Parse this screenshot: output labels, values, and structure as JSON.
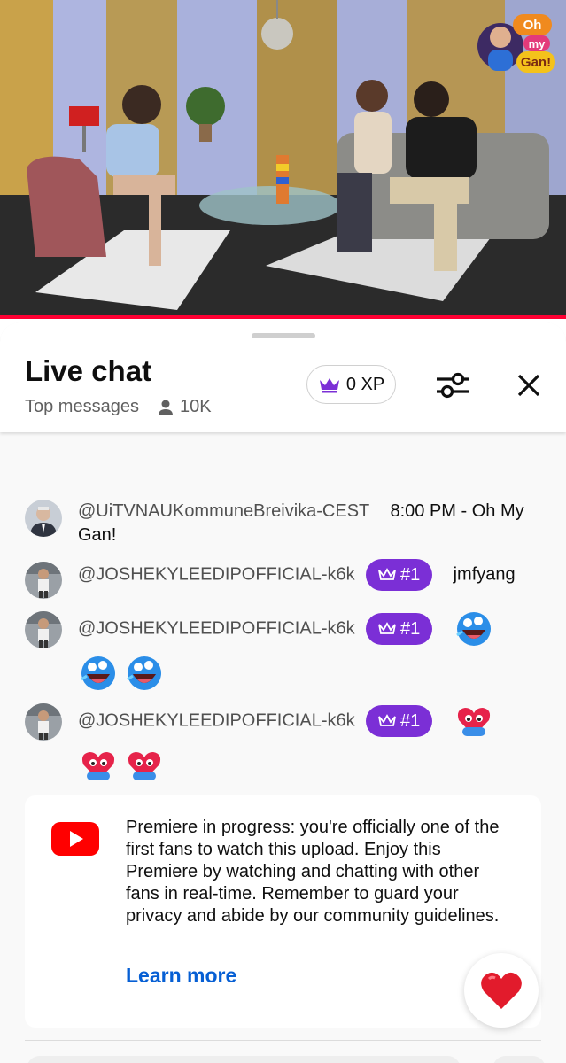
{
  "video": {
    "brand_logo_text": [
      "Oh",
      "my",
      "Gan!"
    ],
    "progress_color": "#ff0033"
  },
  "chat": {
    "title": "Live chat",
    "mode": "Top messages",
    "viewer_count": "10K",
    "xp_label": "0 XP",
    "accent_color": "#7b2fd6",
    "link_color": "#065fd4"
  },
  "messages": [
    {
      "author": "@UiTVNAUKommuneBreivika-CEST",
      "text": "8:00 PM - Oh My Gan!",
      "badge": "",
      "avatar": "avatar-man-suit",
      "emojis": []
    },
    {
      "author": "@JOSHEKYLEEDIPOFFICIAL-k6k",
      "text": "jmfyang",
      "badge": "#1",
      "avatar": "avatar-child",
      "emojis": []
    },
    {
      "author": "@JOSHEKYLEEDIPOFFICIAL-k6k",
      "text": "",
      "badge": "#1",
      "avatar": "avatar-child",
      "emojis": [
        "laughing-blue-emoji",
        "laughing-blue-emoji",
        "laughing-blue-emoji"
      ]
    },
    {
      "author": "@JOSHEKYLEEDIPOFFICIAL-k6k",
      "text": "",
      "badge": "#1",
      "avatar": "avatar-child",
      "emojis": [
        "hugging-heart-emoji",
        "hugging-heart-emoji",
        "hugging-heart-emoji"
      ]
    }
  ],
  "notice": {
    "text": "Premiere in progress: you're officially one of the first fans to watch this upload. Enjoy this Premiere by watching and chatting with other fans in real-time. Remember to guard your privacy and abide by our community guidelines.",
    "link": "Learn more"
  },
  "icons": {
    "crown": "crown-icon",
    "viewers": "person-icon",
    "filter": "sliders-icon",
    "close": "close-icon",
    "youtube": "youtube-logo-icon",
    "reaction": "heart-icon"
  }
}
